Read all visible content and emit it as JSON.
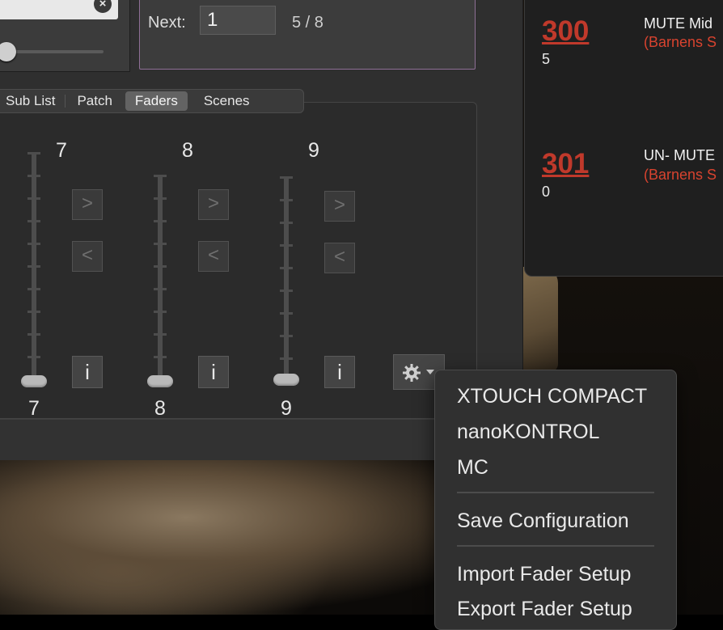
{
  "top_panel": {
    "clear_glyph": "×",
    "next_label": "Next:",
    "next_value": "1",
    "page_count": "5 / 8"
  },
  "tabs": [
    {
      "label": "Sub List",
      "active": false
    },
    {
      "label": "Patch",
      "active": false
    },
    {
      "label": "Faders",
      "active": true
    },
    {
      "label": "Scenes",
      "active": false
    }
  ],
  "faders": [
    {
      "top_label": "7",
      "bottom_label": "7",
      "right_arrow": ">",
      "left_arrow": "<",
      "info": "i"
    },
    {
      "top_label": "8",
      "bottom_label": "8",
      "right_arrow": ">",
      "left_arrow": "<",
      "info": "i"
    },
    {
      "top_label": "9",
      "bottom_label": "9",
      "right_arrow": ">",
      "left_arrow": "<",
      "info": "i"
    }
  ],
  "cues": [
    {
      "number": "300",
      "sub": "5",
      "title": "MUTE  Mid",
      "desc": "(Barnens S"
    },
    {
      "number": "301",
      "sub": "0",
      "title": "UN- MUTE",
      "desc": "(Barnens S"
    }
  ],
  "menu": {
    "items": [
      "XTOUCH COMPACT",
      "nanoKONTROL",
      "MC",
      "Save Configuration",
      "Import Fader Setup",
      "Export Fader Setup"
    ]
  },
  "colors": {
    "cue_number": "#c0392b",
    "cue_desc": "#d8432f",
    "panel_border": "#8e6f96"
  }
}
